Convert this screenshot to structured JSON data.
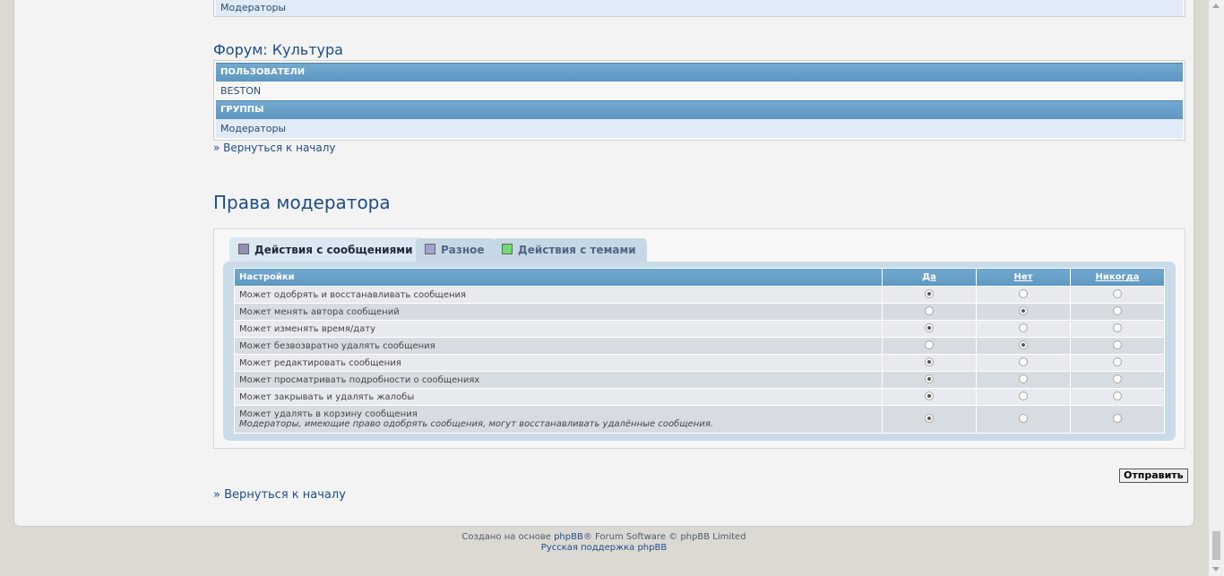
{
  "top_row": {
    "label": "Модераторы"
  },
  "forum": {
    "title": "Форум: Культура",
    "users_header": "Пользователи",
    "user": "BESTON",
    "groups_header": "Группы",
    "group": "Модераторы"
  },
  "back_link": "» Вернуться к началу",
  "section_title": "Права модератора",
  "tabs": [
    {
      "label": "Действия с сообщениями",
      "swatch": "#8f8fb8",
      "active": true
    },
    {
      "label": "Разное",
      "swatch": "#a3a3d1",
      "active": false
    },
    {
      "label": "Действия с темами",
      "swatch": "#6fdc6f",
      "active": false
    }
  ],
  "table": {
    "header_settings": "Настройки",
    "header_yes": "Да",
    "header_no": "Нет",
    "header_never": "Никогда",
    "rows": [
      {
        "label": "Может одобрять и восстанавливать сообщения",
        "value": "yes"
      },
      {
        "label": "Может менять автора сообщений",
        "value": "no"
      },
      {
        "label": "Может изменять время/дату",
        "value": "yes"
      },
      {
        "label": "Может безвозвратно удалять сообщения",
        "value": "no"
      },
      {
        "label": "Может редактировать сообщения",
        "value": "yes"
      },
      {
        "label": "Может просматривать подробности о сообщениях",
        "value": "yes"
      },
      {
        "label": "Может закрывать и удалять жалобы",
        "value": "yes"
      },
      {
        "label": "Может удалять в корзину сообщения",
        "note": "Модераторы, имеющие право одобрять сообщения, могут восстанавливать удалённые сообщения.",
        "value": "yes"
      }
    ]
  },
  "submit_label": "Отправить",
  "footer": {
    "line1_prefix": "Создано на основе ",
    "line1_link": "phpBB",
    "line1_suffix": "® Forum Software © phpBB Limited",
    "line2": "Русская поддержка phpBB"
  }
}
